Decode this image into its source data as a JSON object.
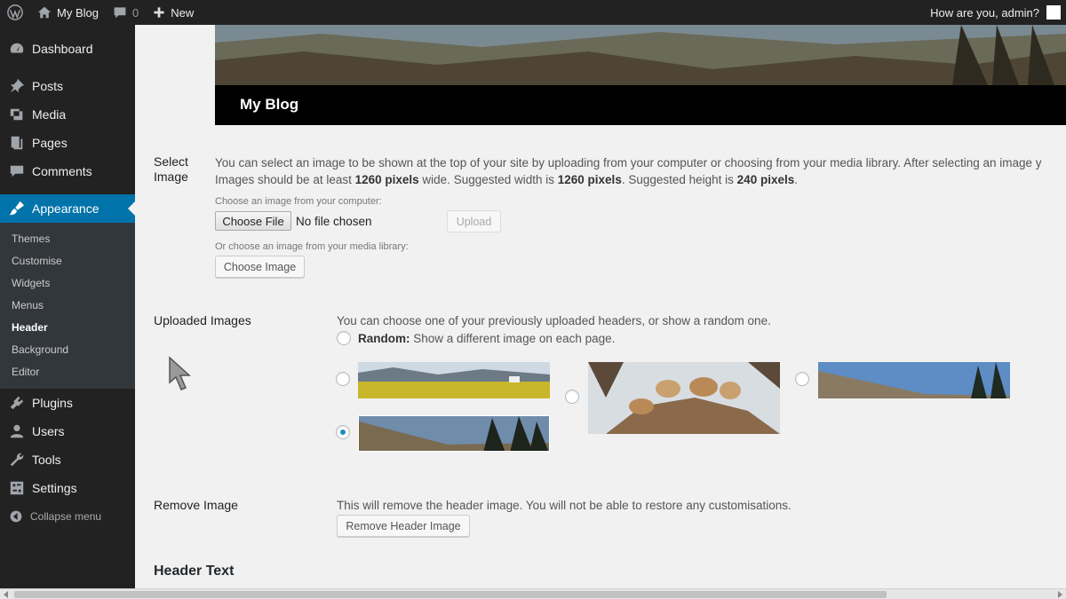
{
  "adminbar": {
    "site_name": "My Blog",
    "comments_count": "0",
    "new_label": "New",
    "greeting": "How are you, admin?"
  },
  "sidebar": {
    "items": [
      {
        "label": "Dashboard",
        "icon": "dashboard-icon"
      },
      {
        "label": "Posts",
        "icon": "pin-icon"
      },
      {
        "label": "Media",
        "icon": "media-icon"
      },
      {
        "label": "Pages",
        "icon": "pages-icon"
      },
      {
        "label": "Comments",
        "icon": "comments-icon"
      },
      {
        "label": "Appearance",
        "icon": "paintbrush-icon"
      },
      {
        "label": "Plugins",
        "icon": "plugin-icon"
      },
      {
        "label": "Users",
        "icon": "users-icon"
      },
      {
        "label": "Tools",
        "icon": "wrench-icon"
      },
      {
        "label": "Settings",
        "icon": "settings-icon"
      }
    ],
    "appearance_sub": [
      "Themes",
      "Customise",
      "Widgets",
      "Menus",
      "Header",
      "Background",
      "Editor"
    ],
    "collapse_label": "Collapse menu",
    "accent_color": "#0073aa"
  },
  "header_preview": {
    "site_title": "My Blog"
  },
  "select_image": {
    "label_line1": "Select",
    "label_line2": "Image",
    "desc_line1": "You can select an image to be shown at the top of your site by uploading from your computer or choosing from your media library. After selecting an image y",
    "desc_line2_a": "Images should be at least ",
    "desc_line2_b": "1260 pixels",
    "desc_line2_c": " wide. Suggested width is ",
    "desc_line2_d": "1260 pixels",
    "desc_line2_e": ". Suggested height is ",
    "desc_line2_f": "240 pixels",
    "desc_line2_g": ".",
    "computer_label": "Choose an image from your computer:",
    "choose_file_label": "Choose File",
    "no_file_text": "No file chosen",
    "upload_label": "Upload",
    "library_label": "Or choose an image from your media library:",
    "choose_image_label": "Choose Image"
  },
  "uploaded_images": {
    "label": "Uploaded Images",
    "desc": "You can choose one of your previously uploaded headers, or show a random one.",
    "random_bold": "Random:",
    "random_text": " Show a different image on each page.",
    "selected_index": 3
  },
  "remove_image": {
    "label": "Remove Image",
    "desc": "This will remove the header image. You will not be able to restore any customisations.",
    "button_label": "Remove Header Image"
  },
  "header_text": {
    "heading": "Header Text"
  }
}
